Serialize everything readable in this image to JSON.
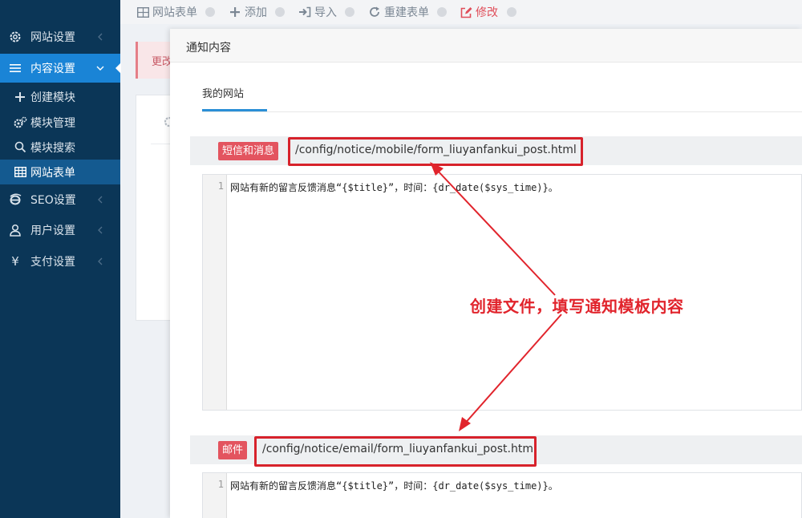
{
  "toolbar": {
    "items": [
      {
        "label": "网站表单",
        "icon": "table-icon"
      },
      {
        "label": "添加",
        "icon": "plus-icon"
      },
      {
        "label": "导入",
        "icon": "import-icon"
      },
      {
        "label": "重建表单",
        "icon": "refresh-icon"
      },
      {
        "label": "修改",
        "icon": "edit-icon"
      }
    ]
  },
  "sidebar": {
    "items": [
      {
        "label": "网站设置",
        "icon": "gear-icon"
      },
      {
        "label": "内容设置",
        "icon": "menu-icon",
        "active": true
      },
      {
        "label": "SEO设置",
        "icon": "ie-icon"
      },
      {
        "label": "用户设置",
        "icon": "user-icon"
      },
      {
        "label": "支付设置",
        "icon": "yen-icon"
      }
    ],
    "subitems": [
      {
        "label": "创建模块",
        "icon": "plus-icon"
      },
      {
        "label": "模块管理",
        "icon": "cogs-icon"
      },
      {
        "label": "模块搜索",
        "icon": "search-icon"
      },
      {
        "label": "网站表单",
        "icon": "table-icon",
        "selected": true
      }
    ]
  },
  "background": {
    "alert_text": "更改"
  },
  "modal": {
    "title": "通知内容",
    "tab": "我的网站",
    "sections": [
      {
        "badge": "短信和消息",
        "path": "/config/notice/mobile/form_liuyanfankui_post.html",
        "line_number": "1",
        "code": "网站有新的留言反馈消息“{$title}”，时间：{dr_date($sys_time)}。"
      },
      {
        "badge": "邮件",
        "path": "/config/notice/email/form_liuyanfankui_post.html",
        "line_number": "1",
        "code": "网站有新的留言反馈消息“{$title}”，时间：{dr_date($sys_time)}。"
      }
    ]
  },
  "annotation": {
    "text": "创建文件，填写通知模板内容"
  },
  "colors": {
    "sidebar_bg": "#0b3657",
    "active_blue": "#1a84d6",
    "annotation_red": "#e1242c",
    "badge_red": "#e3545f"
  }
}
